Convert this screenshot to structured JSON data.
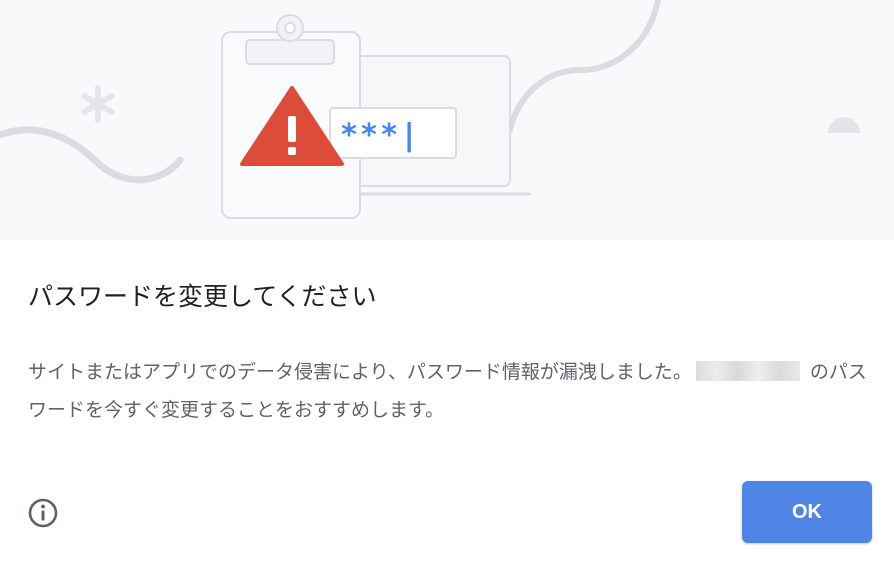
{
  "dialog": {
    "title": "パスワードを変更してください",
    "body_before": "サイトまたはアプリでのデータ侵害により、パスワード情報が漏洩しました。",
    "body_after": "のパスワードを今すぐ変更することをおすすめします。",
    "password_mask": "***|",
    "ok_label": "OK",
    "info_icon": "info-circle-icon"
  },
  "colors": {
    "accent": "#4f86e6",
    "warning": "#dd4b39",
    "illustration_bg": "#f8f9fa",
    "title_text": "#202124",
    "body_text": "#5f6368"
  }
}
